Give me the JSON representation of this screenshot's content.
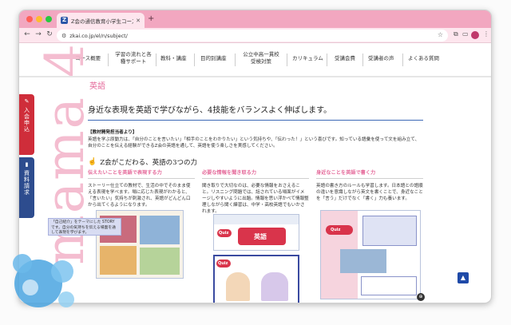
{
  "browser": {
    "tab_title": "Z会の通信教育小学生コース - Z",
    "tab_favicon": "Z",
    "url": "zkai.co.jp/el/n/subject/",
    "icons": [
      "back-arrow-icon",
      "forward-arrow-icon",
      "reload-icon",
      "site-info-icon",
      "bookmark-star-icon",
      "extensions-icon",
      "profile-avatar",
      "menu-dots-icon"
    ]
  },
  "site_nav": {
    "items": [
      {
        "label": "コース概要"
      },
      {
        "label": "学習の流れと各\n種サポート"
      },
      {
        "label": "教科・講座"
      },
      {
        "label": "目的別講座"
      },
      {
        "label": "公立中高一貫校\n受検対策"
      },
      {
        "label": "カリキュラム"
      },
      {
        "label": "受講会費"
      },
      {
        "label": "受講者の声"
      },
      {
        "label": "よくある質問"
      }
    ]
  },
  "side_tabs": {
    "join": "入会申込",
    "docs": "資料請求"
  },
  "decor": {
    "brand_text": "mama 4"
  },
  "main": {
    "section_title": "英語",
    "headline": "身近な表現を英語で学びながら、4技能をバランスよく伸ばします。",
    "staff_label": "【教材開発担当者より】",
    "staff_text": "英語を学ぶ原動力は、「自分のことを言いたい」「相手のことをわかりたい」という気持ちや、「伝わった！」という喜びです。知っている語彙を使って文を組み立て、自分のことを伝える経験ができるZ会の英語を通して、英語を使う楽しさを実感してください。",
    "sub_heading": "Z会がこだわる、英語の3つの力",
    "columns": [
      {
        "heading": "伝えたいことを英語で表現する力",
        "text": "ストーリー仕立ての教材で、生活の中でそのまま使える表現を学べます。場に応じた表現がわかると、「言いたい」気持ちが刺激され、英語がどんどん口から出てくるようになります。"
      },
      {
        "heading": "必要な情報を聞き取る力",
        "text": "聞き取りで大切なのは、必要な情報をおさえること。リスニング問題では、話されている場面がイメージしやすいように出題。情報を思い浮かべて情報整理しながら聞く練習は、中学・高校英語でもいかされます。"
      },
      {
        "heading": "身近なことを英語で書く力",
        "text": "英語の書き方のルールも学習します。日本語との語順の違いを意識しながら英文を書くことで、身近なことを「言う」だけでなく「書く」力も養います。"
      }
    ],
    "thumb_labels": [
      "英語",
      "Quiz"
    ],
    "caption": "「自己紹介」をテーマにした STORY です。自分の気持ちを伝える場面を通して表現を学びます。"
  },
  "colors": {
    "tab_strip": "#f2a7c0",
    "accent_pink": "#e56b9b",
    "accent_blue": "#3d69b6",
    "join_red": "#cf2d3a",
    "docs_navy": "#2d4c8e"
  }
}
